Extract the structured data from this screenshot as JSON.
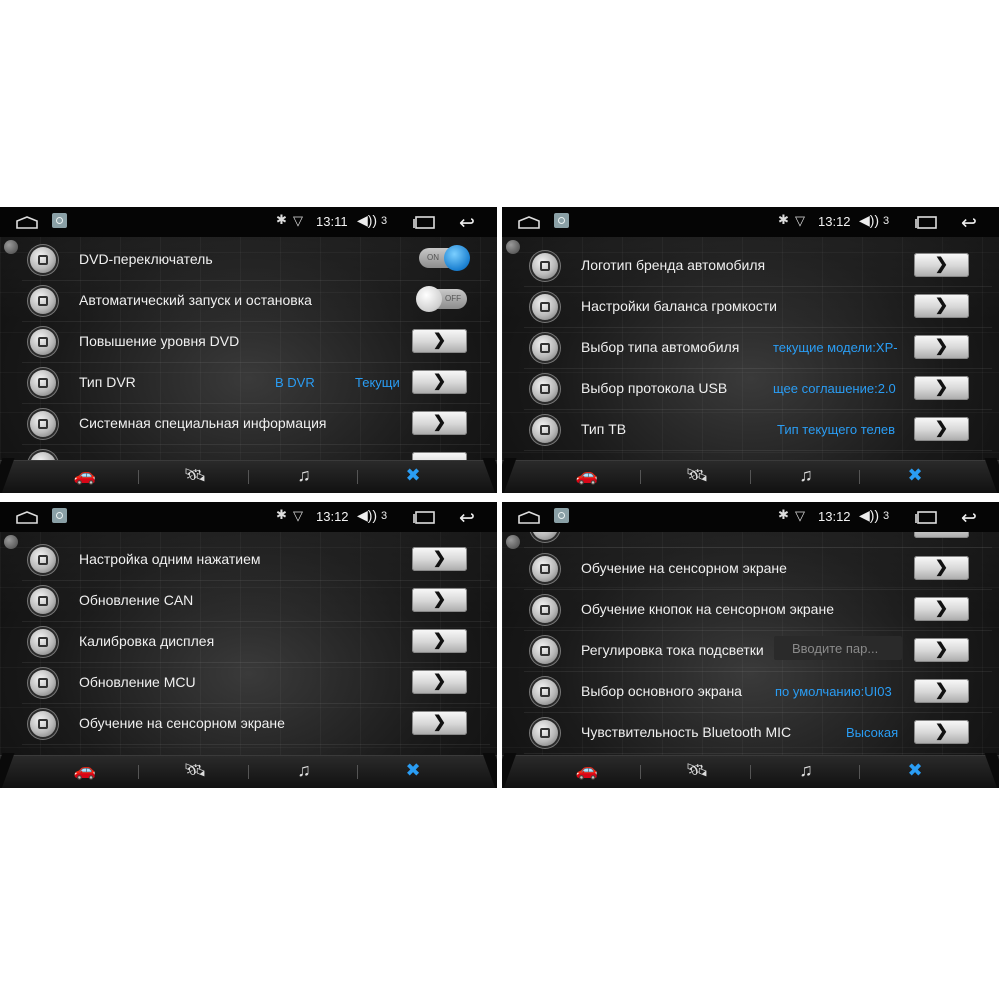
{
  "panels": [
    {
      "status": {
        "time": "13:11",
        "volume": "3"
      },
      "rows": [
        {
          "label": "DVD-переключатель",
          "control": "toggle",
          "state": "on",
          "toggle_label": "ON"
        },
        {
          "label": "Автоматический запуск и остановка",
          "control": "toggle",
          "state": "off",
          "toggle_label": "OFF"
        },
        {
          "label": "Повышение уровня DVD",
          "control": "arrow"
        },
        {
          "label": "Тип DVR",
          "control": "arrow",
          "value": "B DVR",
          "value2": "Текущи"
        },
        {
          "label": "Системная специальная информация",
          "control": "arrow"
        }
      ]
    },
    {
      "status": {
        "time": "13:12",
        "volume": "3"
      },
      "rows": [
        {
          "label": "Логотип бренда автомобиля",
          "control": "arrow",
          "icon": "logo-icon"
        },
        {
          "label": "Настройки баланса громкости",
          "control": "arrow",
          "icon": "speaker-balance-icon"
        },
        {
          "label": "Выбор типа автомобиля",
          "control": "arrow",
          "value": "текущие модели:XP-",
          "icon": "car-icon"
        },
        {
          "label": "Выбор протокола USB",
          "control": "arrow",
          "value": "щее соглашение:2.0",
          "icon": "usb-icon"
        },
        {
          "label": "Тип ТВ",
          "control": "arrow",
          "value": "Тип текущего телев",
          "icon": "tv-icon"
        }
      ]
    },
    {
      "status": {
        "time": "13:12",
        "volume": "3"
      },
      "rows": [
        {
          "label": "Настройка одним нажатием",
          "control": "arrow",
          "icon": "one-touch-icon"
        },
        {
          "label": "Обновление CAN",
          "control": "arrow",
          "icon": "can-icon"
        },
        {
          "label": "Калибровка дисплея",
          "control": "arrow",
          "icon": "display-calibration-icon"
        },
        {
          "label": "Обновление MCU",
          "control": "arrow",
          "icon": "mcu-icon"
        },
        {
          "label": "Обучение на сенсорном экране",
          "control": "arrow",
          "icon": "touch-learning-icon"
        }
      ]
    },
    {
      "status": {
        "time": "13:12",
        "volume": "3"
      },
      "rows": [
        {
          "label": "Обучение на сенсорном экране",
          "control": "arrow",
          "icon": "touch-learning-icon"
        },
        {
          "label": "Обучение кнопок на сенсорном экране",
          "control": "arrow",
          "icon": "touch-buttons-icon"
        },
        {
          "label": "Регулировка тока подсветки",
          "control": "input-arrow",
          "placeholder": "Вводите пар...",
          "icon": "backlight-icon"
        },
        {
          "label": "Выбор основного экрана",
          "control": "arrow",
          "value": "по умолчанию:UI03",
          "icon": "main-screen-icon"
        },
        {
          "label": "Чувствительность Bluetooth MIC",
          "control": "arrow",
          "value": "Высокая",
          "icon": "microphone-icon"
        }
      ]
    }
  ],
  "arrow_glyph": "❯",
  "nav_icons": [
    "car-settings-icon",
    "satellite-icon",
    "sound-eq-icon",
    "tools-icon"
  ],
  "accent_color": "#2a9df4"
}
